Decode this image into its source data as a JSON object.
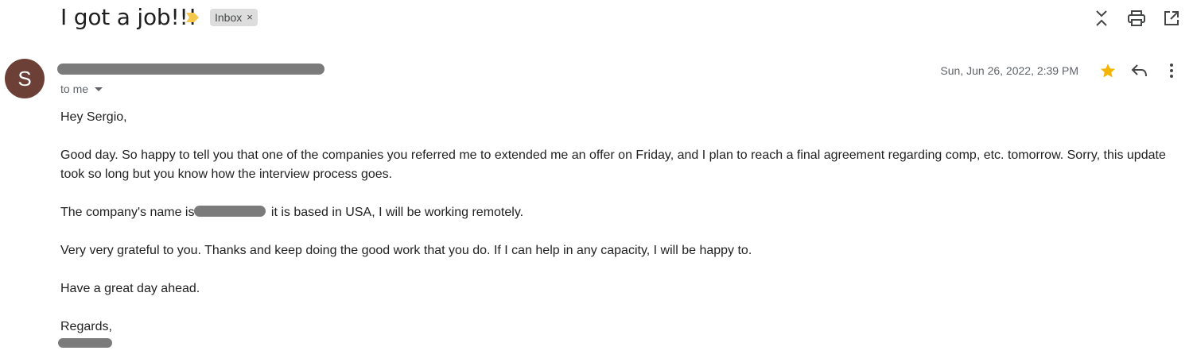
{
  "header": {
    "subject": "I got a job!!!",
    "label": "Inbox",
    "label_remove": "×"
  },
  "toolbar": {
    "icons": [
      "collapse-icon",
      "print-icon",
      "open-in-new-window-icon"
    ]
  },
  "message": {
    "avatar_initial": "S",
    "recipients": "to me",
    "date": "Sun, Jun 26, 2022, 2:39 PM",
    "starred": true,
    "body": {
      "greeting": "Hey Sergio,",
      "paragraph1": "Good day. So happy to tell you that one of the companies you referred me to extended me an offer on Friday, and I plan to reach a final agreement regarding comp, etc. tomorrow. Sorry, this update took so long but you know how the interview process goes.",
      "paragraph2_before": "The company's name is",
      "paragraph2_after": " it is based in USA, I will be working remotely.",
      "paragraph3": "Very very grateful to you. Thanks and keep doing the good work that you do. If I can help in any capacity, I will be happy to.",
      "paragraph4": "Have a great day ahead.",
      "closing": "Regards,"
    }
  },
  "colors": {
    "avatar": "#6d4037",
    "star": "#f4b400",
    "importance": "#f4c84d",
    "chip_bg": "#dddddd",
    "redaction": "#7b7b7b"
  }
}
